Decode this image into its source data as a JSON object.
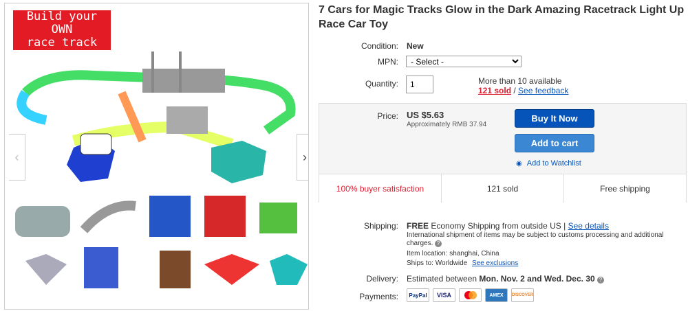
{
  "promo": {
    "line1": "Build your",
    "line2": "OWN",
    "line3": "race track"
  },
  "title": "7 Cars for Magic Tracks Glow in the Dark Amazing Racetrack Light Up Race Car Toy",
  "condition": {
    "label": "Condition:",
    "value": "New"
  },
  "mpn": {
    "label": "MPN:",
    "selected": "- Select -"
  },
  "quantity": {
    "label": "Quantity:",
    "value": "1",
    "available": "More than 10 available",
    "sold": "121 sold",
    "sep": " / ",
    "feedback": "See feedback"
  },
  "price": {
    "label": "Price:",
    "value": "US $5.63",
    "approx": "Approximately RMB 37.94"
  },
  "buttons": {
    "buy": "Buy It Now",
    "cart": "Add to cart",
    "watch": "Add to Watchlist"
  },
  "stats": {
    "satisfaction": "100% buyer satisfaction",
    "sold": "121 sold",
    "shipping": "Free shipping"
  },
  "shipping": {
    "label": "Shipping:",
    "free": "FREE",
    "method": "Economy Shipping from outside US |",
    "details": "See details",
    "intl": "International shipment of items may be subject to customs processing and additional charges.",
    "location_label": "Item location:",
    "location": "shanghai, China",
    "shipsto_label": "Ships to:",
    "shipsto": "Worldwide",
    "exclusions": "See exclusions"
  },
  "delivery": {
    "label": "Delivery:",
    "text": "Estimated between",
    "range": "Mon. Nov. 2 and Wed. Dec. 30"
  },
  "payments": {
    "label": "Payments:",
    "methods": [
      "PayPal",
      "VISA",
      "MC",
      "AMEX",
      "DISCOVER"
    ]
  },
  "colors": {
    "accent": "#0654ba",
    "red": "#dd1e31"
  }
}
